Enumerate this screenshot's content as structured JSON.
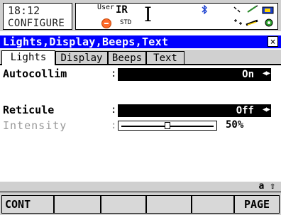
{
  "status": {
    "time": "18:12",
    "mode": "CONFIGURE",
    "user_label": "User",
    "ir_label": "IR",
    "std_label": "STD",
    "i_label": "I",
    "icons": [
      "bluetooth-icon",
      "measure-icon",
      "pen-icon",
      "battery-icon",
      "satellite-icon",
      "tool-icon",
      "stylus-icon"
    ]
  },
  "window": {
    "title": "Lights,Display,Beeps,Text",
    "close_glyph": "×"
  },
  "tabs": [
    "Lights",
    "Display",
    "Beeps",
    "Text"
  ],
  "active_tab": 0,
  "fields": {
    "autocollim": {
      "label": "Autocollim",
      "colon": ":",
      "value": "On"
    },
    "reticule": {
      "label": "Reticule",
      "colon": ":",
      "value": "Off"
    },
    "intensity": {
      "label": "Intensity",
      "colon": ":",
      "value": "50%",
      "level": 0.5
    }
  },
  "case_indicator": "a ⇧",
  "softkeys": {
    "f1": "CONT",
    "f2": "",
    "f3": "",
    "f4": "",
    "f5": "",
    "f6": "PAGE"
  }
}
